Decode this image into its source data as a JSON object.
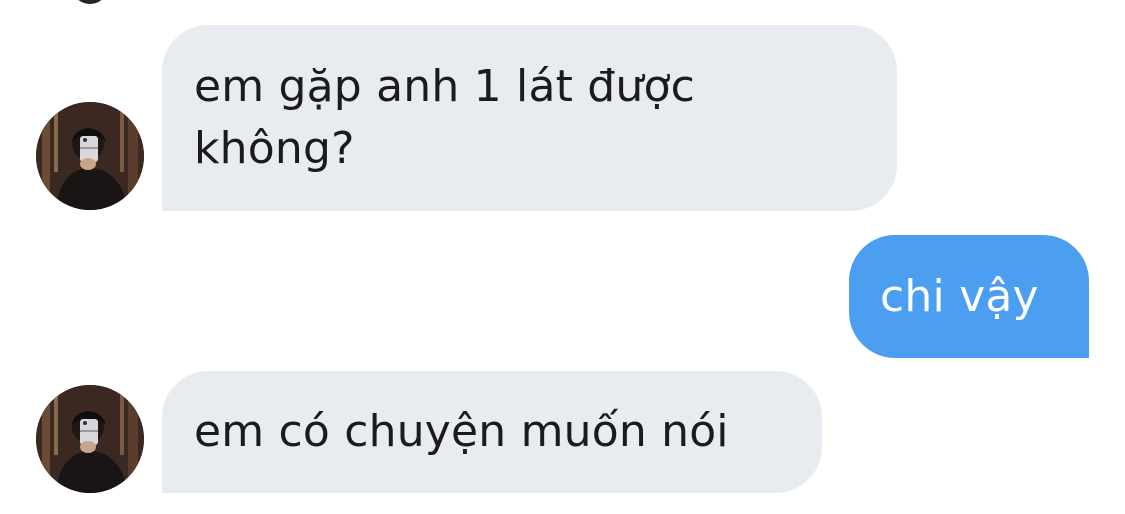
{
  "messages": [
    {
      "direction": "incoming",
      "text_line1": "em gặp anh 1 lát được",
      "text_line2": "không?"
    },
    {
      "direction": "outgoing",
      "text": "chi vậy"
    },
    {
      "direction": "incoming",
      "text": "em có chuyện muốn nói"
    }
  ],
  "colors": {
    "incoming_bubble": "#e8ebef",
    "outgoing_bubble": "#4b9ef0",
    "text_dark": "#1b1b1f",
    "text_light": "#ffffff"
  },
  "icons": {
    "avatar": "contact-avatar-photo"
  }
}
